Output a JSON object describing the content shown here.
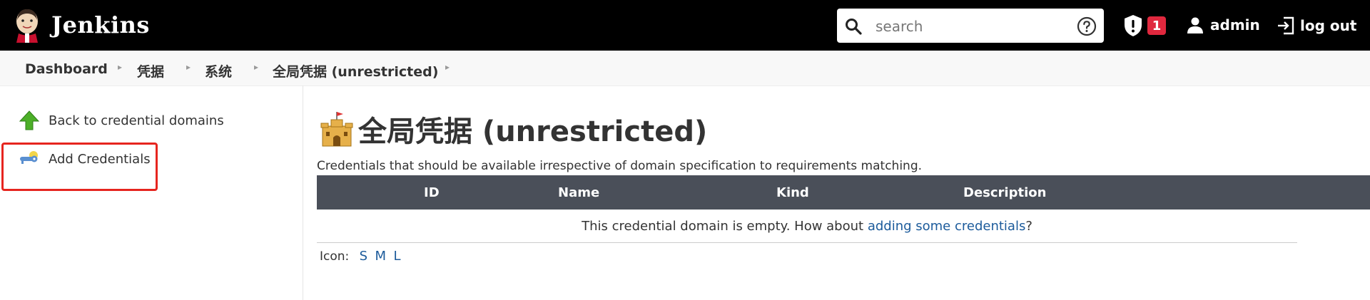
{
  "header": {
    "app_title": "Jenkins",
    "search_placeholder": "search",
    "security_badge_count": "1",
    "user_name": "admin",
    "logout_label": "log out",
    "badge_color": "#e0283e"
  },
  "breadcrumb": {
    "items": [
      "Dashboard",
      "凭据",
      "系统",
      "全局凭据 (unrestricted)"
    ]
  },
  "sidebar": {
    "items": [
      {
        "label": "Back to credential domains",
        "icon": "green-up-arrow-icon"
      },
      {
        "label": "Add Credentials",
        "icon": "key-icon"
      }
    ]
  },
  "main": {
    "title": "全局凭据 (unrestricted)",
    "description": "Credentials that should be available irrespective of domain specification to requirements matching.",
    "table": {
      "headers": [
        "ID",
        "Name",
        "Kind",
        "Description"
      ],
      "empty_prefix": "This credential domain is empty. How about ",
      "empty_link": "adding some credentials",
      "empty_suffix": "?"
    },
    "icon_label": "Icon:",
    "icon_sizes": [
      "S",
      "M",
      "L"
    ]
  }
}
